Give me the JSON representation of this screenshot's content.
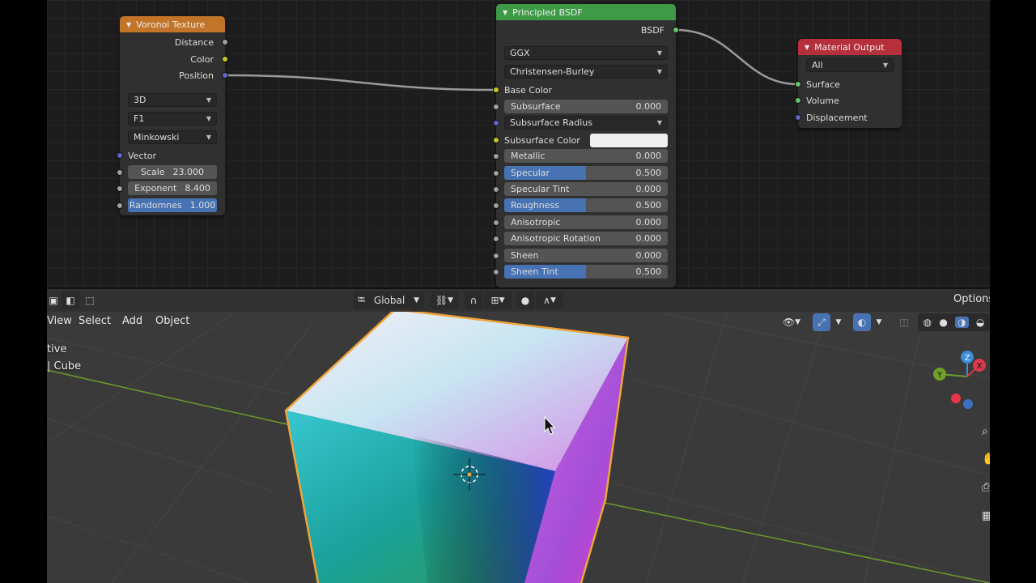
{
  "nodes": {
    "voronoi": {
      "title": "Voronoi Texture",
      "header_color": "#c27428",
      "outputs": [
        "Distance",
        "Color",
        "Position"
      ],
      "dimensions": "3D",
      "feature": "F1",
      "metric": "Minkowski",
      "vector_label": "Vector",
      "scale_label": "Scale",
      "scale_value": "23.000",
      "exponent_label": "Exponent",
      "exponent_value": "8.400",
      "randomness_label": "Randomnes",
      "randomness_value": "1.000"
    },
    "bsdf": {
      "title": "Principled BSDF",
      "header_color": "#3e9a46",
      "output": "BSDF",
      "distribution": "GGX",
      "subsurface_method": "Christensen-Burley",
      "base_color_label": "Base Color",
      "subsurface_label": "Subsurface",
      "subsurface_value": "0.000",
      "subsurface_radius_label": "Subsurface Radius",
      "subsurface_color_label": "Subsurface Color",
      "metallic_label": "Metallic",
      "metallic_value": "0.000",
      "specular_label": "Specular",
      "specular_value": "0.500",
      "specular_tint_label": "Specular Tint",
      "specular_tint_value": "0.000",
      "roughness_label": "Roughness",
      "roughness_value": "0.500",
      "anisotropic_label": "Anisotropic",
      "anisotropic_value": "0.000",
      "anisotropic_rotation_label": "Anisotropic Rotation",
      "anisotropic_rotation_value": "0.000",
      "sheen_label": "Sheen",
      "sheen_value": "0.000",
      "sheen_tint_label": "Sheen Tint",
      "sheen_tint_value": "0.500",
      "specular_fill": 0.5,
      "roughness_fill": 0.5,
      "sheen_tint_fill": 0.5
    },
    "output": {
      "title": "Material Output",
      "header_color": "#b5303a",
      "target": "All",
      "inputs": [
        "Surface",
        "Volume",
        "Displacement"
      ]
    }
  },
  "viewport": {
    "header": {
      "transform_orientation": "Global",
      "options_label": "Options"
    },
    "menu": [
      "View",
      "Select",
      "Add",
      "Object"
    ],
    "overlay": {
      "mode_text": "tive",
      "object_text": "| Cube"
    },
    "gizmo": {
      "x": "X",
      "y": "Y",
      "z": "Z"
    }
  }
}
